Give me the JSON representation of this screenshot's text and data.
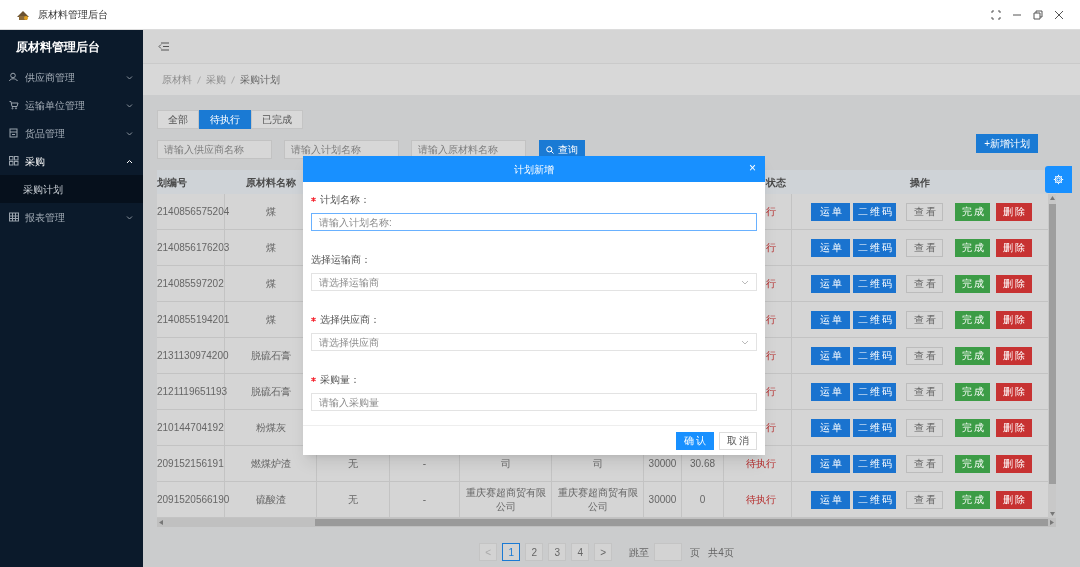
{
  "window": {
    "title": "原材料管理后台"
  },
  "sidebar": {
    "title": "原材料管理后台",
    "items": [
      {
        "label": "供应商管理",
        "expanded": false
      },
      {
        "label": "运输单位管理",
        "expanded": false
      },
      {
        "label": "货品管理",
        "expanded": false
      },
      {
        "label": "采购",
        "expanded": true,
        "children": [
          {
            "label": "采购计划",
            "selected": true
          }
        ]
      },
      {
        "label": "报表管理",
        "expanded": false
      }
    ]
  },
  "breadcrumb": [
    "原材料",
    "采购",
    "采购计划"
  ],
  "tabs": [
    {
      "label": "全部",
      "selected": false
    },
    {
      "label": "待执行",
      "selected": true
    },
    {
      "label": "已完成",
      "selected": false
    }
  ],
  "filters": [
    {
      "placeholder": "请输入供应商名称"
    },
    {
      "placeholder": "请输入计划名称"
    },
    {
      "placeholder": "请输入原材料名称"
    }
  ],
  "search_button": "查询",
  "add_button": "+新增计划",
  "table": {
    "headers": {
      "plan_no": "划编号",
      "material": "原材料名称",
      "status": "状态",
      "actions": "操作"
    },
    "rows": [
      {
        "plan_no": "2140856575204",
        "material": "煤",
        "status": "行",
        "actions": [
          {
            "label": "运单",
            "kind": "primary"
          },
          {
            "label": "二维码",
            "kind": "primary"
          },
          {
            "label": "查看",
            "kind": "default"
          },
          {
            "label": "完成",
            "kind": "success"
          },
          {
            "label": "删除",
            "kind": "danger"
          }
        ]
      },
      {
        "plan_no": "2140856176203",
        "material": "煤",
        "status": "行",
        "actions": [
          {
            "label": "运单",
            "kind": "primary"
          },
          {
            "label": "二维码",
            "kind": "primary"
          },
          {
            "label": "查看",
            "kind": "default"
          },
          {
            "label": "完成",
            "kind": "success"
          },
          {
            "label": "删除",
            "kind": "danger"
          }
        ]
      },
      {
        "plan_no": "214085597202",
        "material": "煤",
        "status": "行",
        "actions": [
          {
            "label": "运单",
            "kind": "primary"
          },
          {
            "label": "二维码",
            "kind": "primary"
          },
          {
            "label": "查看",
            "kind": "default"
          },
          {
            "label": "完成",
            "kind": "success"
          },
          {
            "label": "删除",
            "kind": "danger"
          }
        ]
      },
      {
        "plan_no": "2140855194201",
        "material": "煤",
        "status": "行",
        "actions": [
          {
            "label": "运单",
            "kind": "primary"
          },
          {
            "label": "二维码",
            "kind": "primary"
          },
          {
            "label": "查看",
            "kind": "default"
          },
          {
            "label": "完成",
            "kind": "success"
          },
          {
            "label": "删除",
            "kind": "danger"
          }
        ]
      },
      {
        "plan_no": "2131130974200",
        "material": "脱硫石膏",
        "status": "行",
        "actions": [
          {
            "label": "运单",
            "kind": "primary"
          },
          {
            "label": "二维码",
            "kind": "primary"
          },
          {
            "label": "查看",
            "kind": "default"
          },
          {
            "label": "完成",
            "kind": "success"
          },
          {
            "label": "删除",
            "kind": "danger"
          }
        ]
      },
      {
        "plan_no": "2121119651193",
        "material": "脱硫石膏",
        "status": "行",
        "actions": [
          {
            "label": "运单",
            "kind": "primary"
          },
          {
            "label": "二维码",
            "kind": "primary"
          },
          {
            "label": "查看",
            "kind": "default"
          },
          {
            "label": "完成",
            "kind": "success"
          },
          {
            "label": "删除",
            "kind": "danger"
          }
        ]
      },
      {
        "plan_no": "210144704192",
        "material": "粉煤灰",
        "status": "行",
        "actions": [
          {
            "label": "运单",
            "kind": "primary"
          },
          {
            "label": "二维码",
            "kind": "primary"
          },
          {
            "label": "查看",
            "kind": "default"
          },
          {
            "label": "完成",
            "kind": "success"
          },
          {
            "label": "删除",
            "kind": "danger"
          }
        ]
      },
      {
        "plan_no": "209152156191",
        "material": "燃煤炉渣",
        "column_3": "无",
        "column_4": "-",
        "column_5": "司",
        "column_6": "司",
        "column_7": "30000",
        "column_8": "30.68",
        "status": "待执行",
        "actions": [
          {
            "label": "运单",
            "kind": "primary"
          },
          {
            "label": "二维码",
            "kind": "primary"
          },
          {
            "label": "查看",
            "kind": "default"
          },
          {
            "label": "完成",
            "kind": "success"
          },
          {
            "label": "删除",
            "kind": "danger"
          }
        ]
      },
      {
        "plan_no": "2091520566190",
        "material": "硫酸渣",
        "column_3": "无",
        "column_4": "-",
        "column_5": "重庆赛超商贸有限公司",
        "column_6": "重庆赛超商贸有限公司",
        "column_7": "30000",
        "column_8": "0",
        "status": "待执行",
        "actions": [
          {
            "label": "运单",
            "kind": "primary"
          },
          {
            "label": "二维码",
            "kind": "primary"
          },
          {
            "label": "查看",
            "kind": "default"
          },
          {
            "label": "完成",
            "kind": "success"
          },
          {
            "label": "删除",
            "kind": "danger"
          }
        ]
      }
    ]
  },
  "pagination": {
    "prev": "<",
    "pages": [
      {
        "label": "1",
        "selected": true
      },
      {
        "label": "2",
        "selected": false
      },
      {
        "label": "3",
        "selected": false
      },
      {
        "label": "4",
        "selected": false
      }
    ],
    "next": ">",
    "jump_label": "跳至",
    "page_unit": "页",
    "total": "共4页"
  },
  "modal": {
    "title": "计划新增",
    "close": "×",
    "fields": [
      {
        "label": "计划名称：",
        "required": true,
        "kind": "input",
        "placeholder": "请输入计划名称:",
        "focused": true
      },
      {
        "label": "选择运输商：",
        "required": false,
        "kind": "select",
        "placeholder": "请选择运输商",
        "focused": false
      },
      {
        "label": "选择供应商：",
        "required": true,
        "kind": "select",
        "placeholder": "请选择供应商",
        "focused": false
      },
      {
        "label": "采购量：",
        "required": true,
        "kind": "input",
        "placeholder": "请输入采购量",
        "focused": false
      }
    ],
    "buttons": [
      {
        "label": "确认",
        "kind": "primary"
      },
      {
        "label": "取消",
        "kind": "default"
      }
    ]
  }
}
